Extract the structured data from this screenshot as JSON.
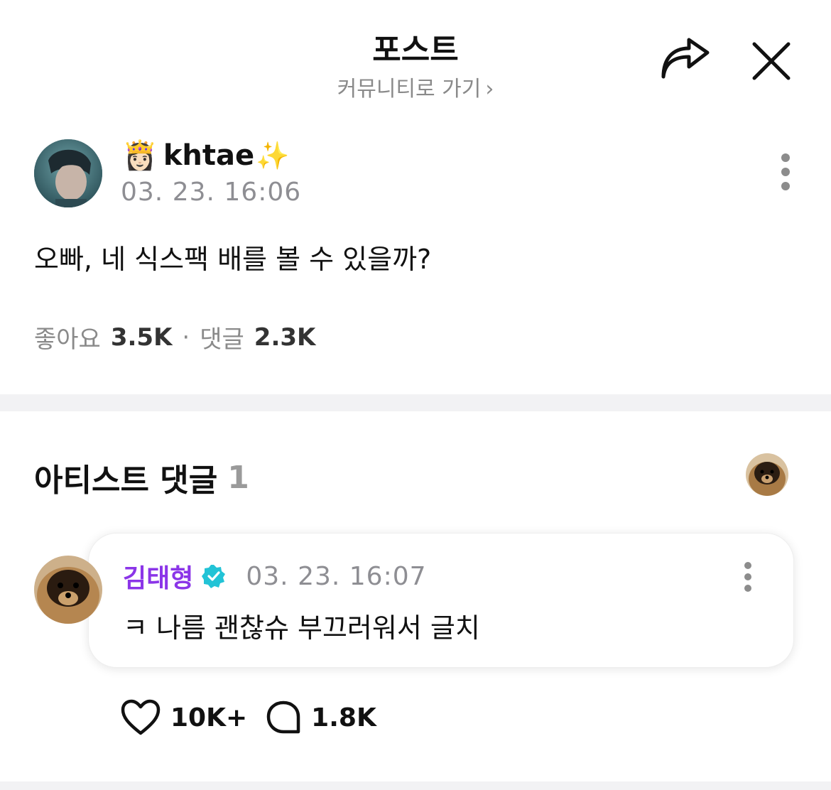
{
  "header": {
    "title": "포스트",
    "community_link": "커뮤니티로 가기",
    "share_icon": "share-icon",
    "close_icon": "close-icon"
  },
  "post": {
    "author_prefix_emoji": "👸🏻",
    "author_name": "khtae",
    "author_suffix_emoji": "✨",
    "timestamp": "03. 23. 16:06",
    "body": "오빠, 네 식스팩 배를 볼 수 있을까?",
    "likes_label": "좋아요",
    "likes_count": "3.5K",
    "comments_label": "댓글",
    "comments_count": "2.3K"
  },
  "artist_comments": {
    "heading": "아티스트 댓글",
    "count": "1",
    "comment": {
      "author": "김태형",
      "verified_icon": "verified-badge-icon",
      "timestamp": "03. 23. 16:07",
      "text": "ㅋ 나름 괜찮슈 부끄러워서 글치",
      "likes": "10K+",
      "replies": "1.8K"
    }
  },
  "colors": {
    "artist_name": "#8b35e8",
    "verified_badge": "#22c3d6",
    "muted_text": "#8e8e93",
    "divider": "#f2f2f4"
  }
}
